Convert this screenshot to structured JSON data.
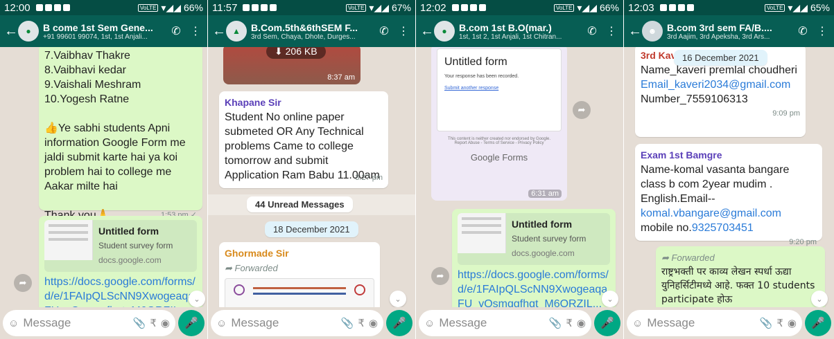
{
  "status_bars": [
    {
      "time": "12:00",
      "battery": "66%"
    },
    {
      "time": "11:57",
      "battery": "67%"
    },
    {
      "time": "12:02",
      "battery": "66%"
    },
    {
      "time": "12:03",
      "battery": "65%"
    }
  ],
  "volte": "VoLTE",
  "input_placeholder": "Message",
  "chats": [
    {
      "title": "B come 1st Sem Gene...",
      "subtitle": "+91 99601 99074, 1st, 1st Anjali...",
      "list": [
        "7.Vaibhav Thakre",
        "8.Vaibhavi kedar",
        "9.Vaishali Meshram",
        "10.Yogesh Ratne"
      ],
      "note": "Ye sabhi students Apni information Google Form me jaldi submit karte hai ya koi problem hai to  college me Aakar milte hai",
      "thanks": "Thank you",
      "thanks_time": "1:53 pm",
      "preview_title": "Untitled form",
      "preview_sub": "Student survey form",
      "preview_domain": "docs.google.com",
      "link": "https://docs.google.com/forms/d/e/1FAIpQLScNN9Xwogeaqa FU_yQsmqgfhgt_M6ORZIL..."
    },
    {
      "title": "B.Com.5th&6thSEM F...",
      "subtitle": "3rd Sem, Chaya, Dhote, Durges...",
      "file_size": "206 KB",
      "file_time": "8:37 am",
      "sender": "Khapane Sir",
      "message": "Student No online paper submeted OR Any Technical problems Came to college tomorrow and submit Application Ram Babu 11.00am",
      "msg_time": "3:27 pm",
      "unread": "44 Unread Messages",
      "date": "18 December 2021",
      "sender2": "Ghormade Sir",
      "forwarded": "Forwarded"
    },
    {
      "title": "B.com 1st B.O(mar.)",
      "subtitle": "1st, 1st 2, 1st Anjali, 1st Chitran...",
      "form_title": "Untitled form",
      "form_recorded": "Your response has been recorded.",
      "form_submit_another": "Submit another response",
      "form_footer": "This content is neither created nor endorsed by Google. Report Abuse - Terms of Service - Privacy Policy",
      "form_brand": "Google Forms",
      "img_time": "6:31 am",
      "preview_title": "Untitled form",
      "preview_sub": "Student survey form",
      "preview_domain": "docs.google.com",
      "link": "https://docs.google.com/forms/d/e/1FAIpQLScNN9Xwogeaqa FU_yQsmqgfhgt_M6ORZIL..."
    },
    {
      "title": "B.com 3rd sem FA/B....",
      "subtitle": "3rd Aajim, 3rd Apeksha, 3rd Ars...",
      "sender_top": "3rd Kave",
      "date_pill": "16 December 2021",
      "name_lines": "Name_kaveri premlal choudheri",
      "email": "Email_kaveri2034@gmail.com",
      "number": "Number_7559106313",
      "time1": "9:09 pm",
      "sender2": "Exam 1st Bamgre",
      "msg2": "Name-komal vasanta bangare  class b com 2year mudim . English.Email--",
      "email2": "komal.vbangare@gmail.com",
      "mobile_label": "mobile no.",
      "mobile": "9325703451",
      "time2": "9:20 pm",
      "forwarded": "Forwarded",
      "hindi": "राष्ट्रभक्ती पर काव्य लेखन स्पर्धा ऊद्या युनिहर्सिटीमध्ये आहे. फक्त 10 students participate होऊ"
    }
  ]
}
